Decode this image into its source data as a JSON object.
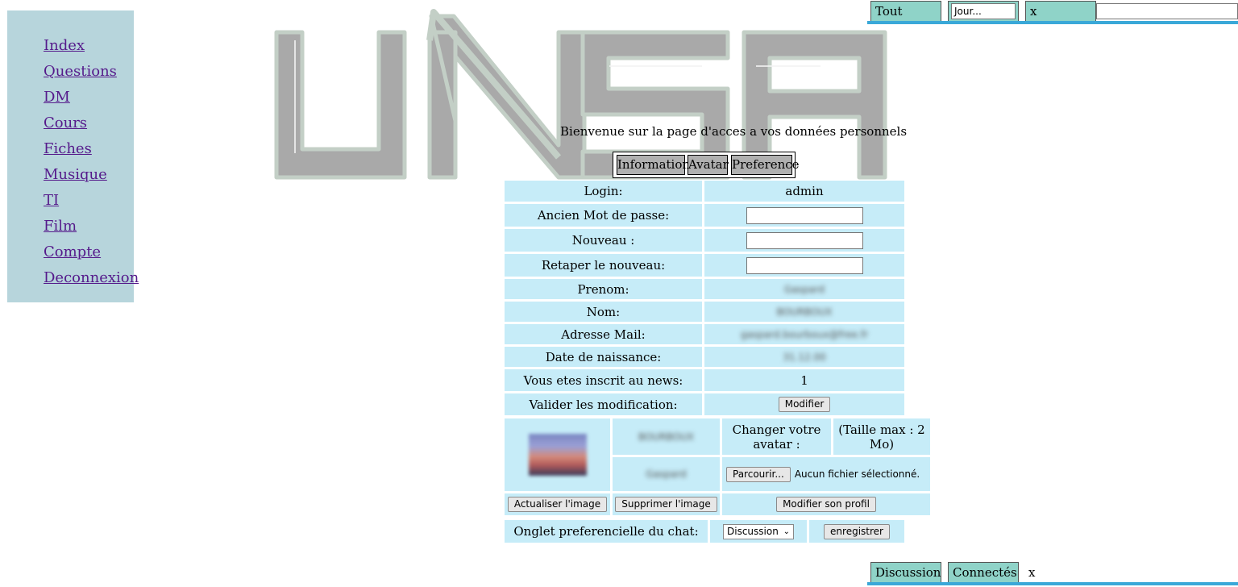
{
  "nav": {
    "items": [
      "Index",
      "Questions",
      "DM",
      "Cours",
      "Fiches",
      "Musique",
      "TI",
      "Film",
      "Compte",
      "Deconnexion"
    ]
  },
  "logo": {
    "text": "UNSA"
  },
  "chat_top": {
    "tab_all": "Tout",
    "search_value": "Jour...",
    "close": "x"
  },
  "welcome": "Bienvenue sur la page d'acces a vos données personnels",
  "tabs": [
    "Information",
    "Avatar",
    "Preference"
  ],
  "form": {
    "login_label": "Login:",
    "login_value": "admin",
    "old_password_label": "Ancien Mot de passe:",
    "new_label": "Nouveau :",
    "retype_label": "Retaper le nouveau:",
    "firstname_label": "Prenom:",
    "firstname_value": "Gaspard",
    "lastname_label": "Nom:",
    "lastname_value": "BOURBOUX",
    "email_label": "Adresse Mail:",
    "email_value": "gaspard.bourboux@free.fr",
    "birth_label": "Date de naissance:",
    "birth_value": "31.12.00",
    "news_label": "Vous etes inscrit au news:",
    "news_value": "1",
    "validate_label": "Valider les modification:",
    "validate_button": "Modifier"
  },
  "avatar": {
    "name_blurred": "BOURBOUX",
    "first_blurred": "Gaspard",
    "change_label": "Changer votre avatar :",
    "size_label": "(Taille max : 2 Mo)",
    "browse_button": "Parcourir...",
    "no_file": "Aucun fichier sélectionné.",
    "refresh_button": "Actualiser l'image",
    "delete_button": "Supprimer l'image",
    "profile_button": "Modifier son profil"
  },
  "preference": {
    "label": "Onglet preferencielle du chat:",
    "select_value": "Discussion",
    "save_button": "enregistrer"
  },
  "chat_bottom": {
    "tab_discussion": "Discussion",
    "tab_connected": "Connectés",
    "close": "x"
  },
  "colors": {
    "sidebar_bg": "#b7d5dc",
    "cell_bg": "#c6ecf8",
    "tab_bg": "#8fd3c8",
    "accent_line": "#3aa8d8"
  }
}
